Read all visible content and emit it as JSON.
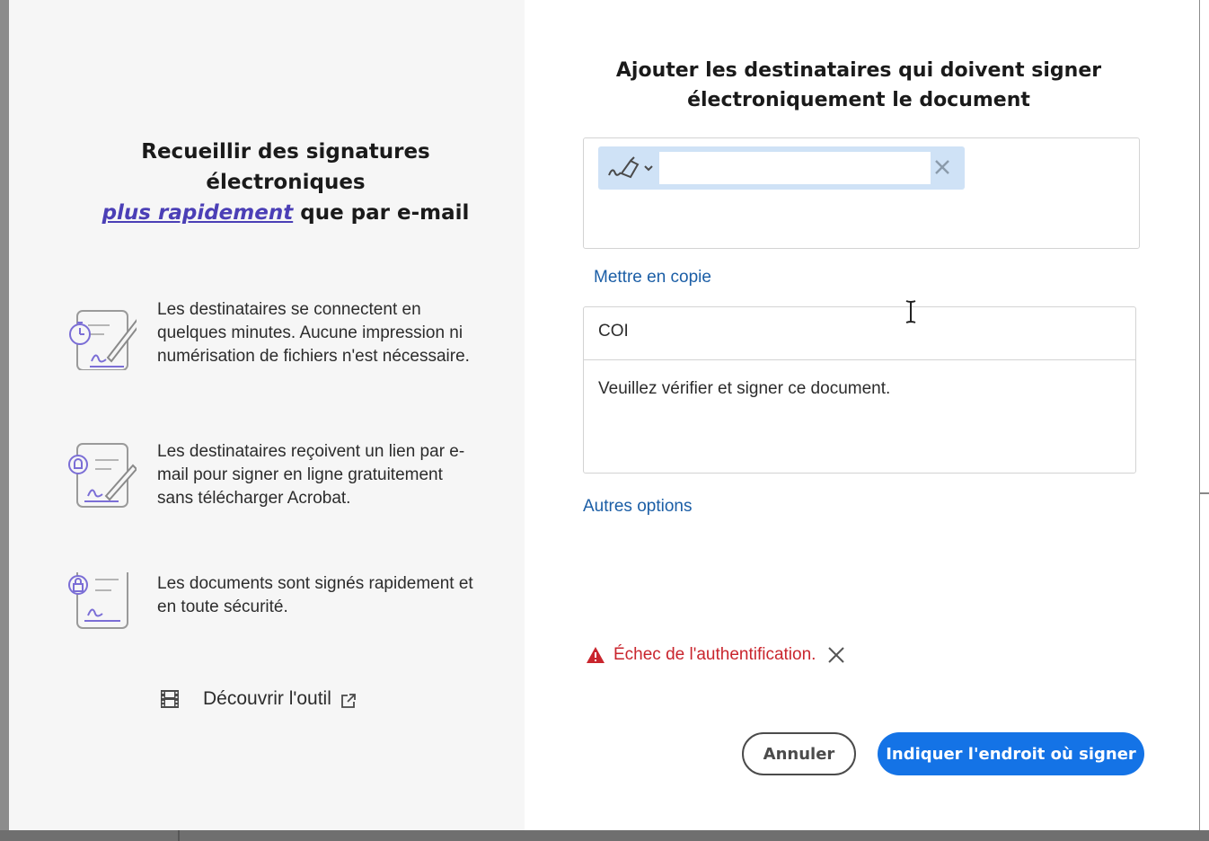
{
  "left": {
    "heading_line1": "Recueillir des signatures",
    "heading_line2": "électroniques",
    "heading_highlight": "plus rapidement",
    "heading_rest": " que par e-mail",
    "features": [
      {
        "icon": "timer-signature-icon",
        "text": "Les destinataires se connectent en quelques minutes. Aucune impression ni numérisation de fichiers n'est nécessaire."
      },
      {
        "icon": "email-signature-icon",
        "text": "Les destinataires reçoivent un lien par e-mail pour signer en ligne gratuitement sans télécharger Acrobat."
      },
      {
        "icon": "lock-document-icon",
        "text": "Les documents sont signés rapidement et en toute sécurité."
      }
    ],
    "discover_label": "Découvrir l'outil"
  },
  "right": {
    "title_line1": "Ajouter les destinataires qui doivent signer",
    "title_line2": "électroniquement le document",
    "recipient_value": "",
    "cc_label": "Mettre en copie",
    "subject_value": "COI",
    "message_value": "Veuillez vérifier et signer ce document.",
    "more_options": "Autres options",
    "error_text": "Échec de l'authentification.",
    "cancel_label": "Annuler",
    "primary_label": "Indiquer l'endroit où signer"
  },
  "colors": {
    "accent": "#1473e6",
    "link": "#1b5ea6",
    "error": "#c9252d",
    "highlight": "#4b3fb6",
    "chip": "#cfe2f6"
  }
}
